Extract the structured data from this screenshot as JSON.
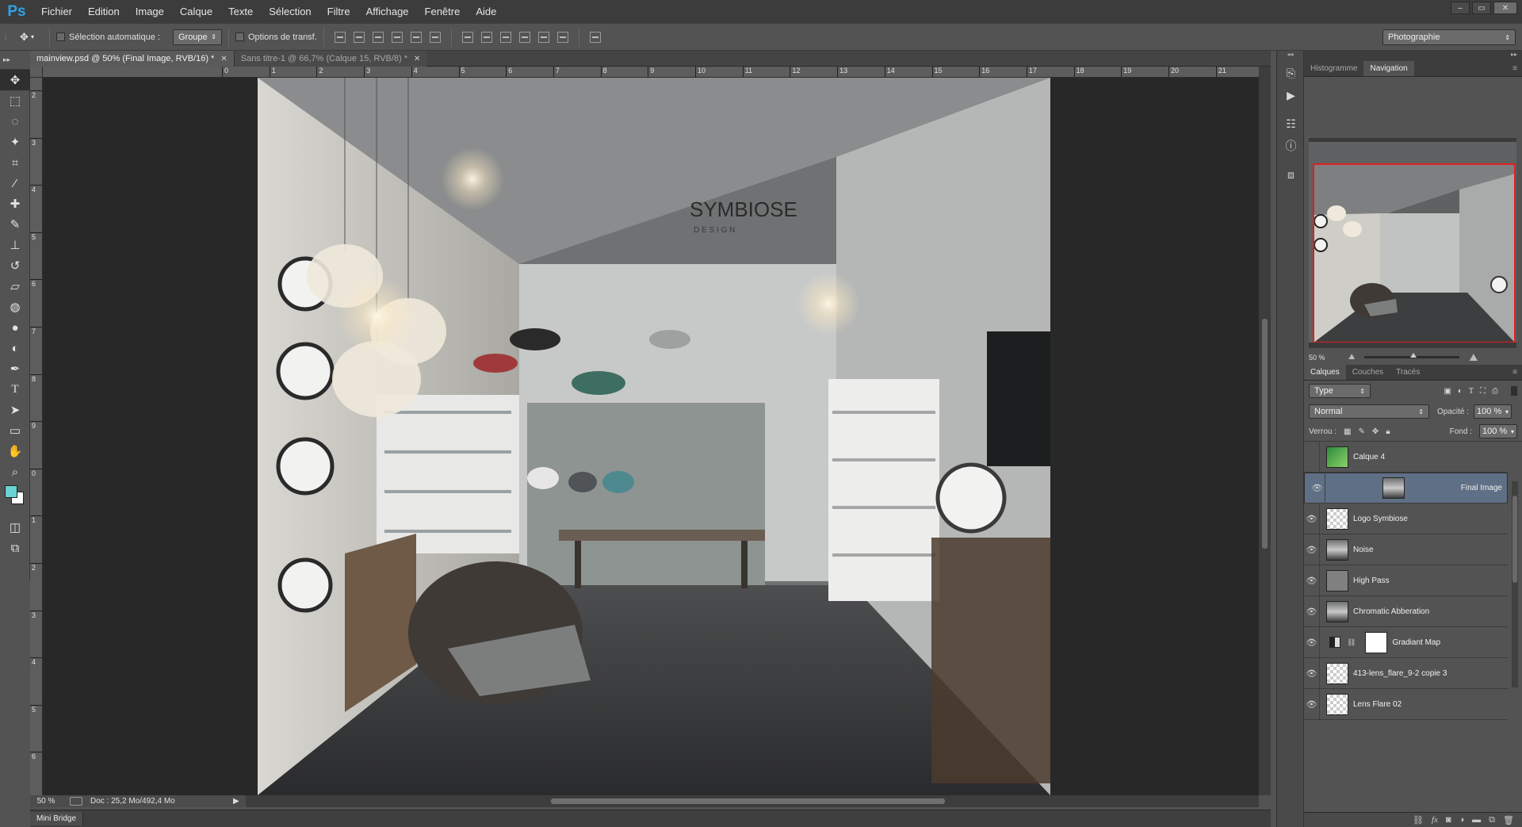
{
  "app": {
    "logo": "Ps"
  },
  "menu": [
    "Fichier",
    "Edition",
    "Image",
    "Calque",
    "Texte",
    "Sélection",
    "Filtre",
    "Affichage",
    "Fenêtre",
    "Aide"
  ],
  "window_controls": [
    "–",
    "▭",
    "✕"
  ],
  "options": {
    "auto_select_label": "Sélection automatique :",
    "auto_select_value": "Groupe",
    "transform_label": "Options de transf.",
    "workspace": "Photographie"
  },
  "tabs": [
    {
      "label": "mainview.psd @ 50% (Final Image, RVB/16) *",
      "close": "✕"
    },
    {
      "label": "Sans titre-1 @ 66,7% (Calque 15, RVB/8) *",
      "close": "✕"
    }
  ],
  "ruler": {
    "h": [
      "0",
      "1",
      "2",
      "3",
      "4",
      "5",
      "6",
      "7",
      "8",
      "9",
      "10",
      "11",
      "12",
      "13",
      "14",
      "15",
      "16",
      "17",
      "18",
      "19",
      "20",
      "21"
    ],
    "v": [
      "2",
      "3",
      "4",
      "5",
      "6",
      "7",
      "8",
      "9",
      "0",
      "1",
      "2",
      "3",
      "4",
      "5",
      "6"
    ]
  },
  "canvas": {
    "logo_title": "SYMBIOSE",
    "logo_sub": "D E S I G N"
  },
  "status": {
    "zoom": "50 %",
    "doc": "Doc : 25,2 Mo/492,4 Mo"
  },
  "mini_bridge": "Mini Bridge",
  "nav_panel": {
    "tabs": [
      "Histogramme",
      "Navigation"
    ],
    "active": "Navigation",
    "zoom": "50 %"
  },
  "layers_panel": {
    "tabs": [
      "Calques",
      "Couches",
      "Tracés"
    ],
    "filter": "Type",
    "blend_mode": "Normal",
    "opacity_label": "Opacité :",
    "opacity": "100 %",
    "lock_label": "Verrou :",
    "fill_label": "Fond :",
    "fill": "100 %",
    "layers": [
      {
        "name": "Calque 4",
        "visible": false,
        "thumb": "green"
      },
      {
        "name": "Final Image",
        "visible": true,
        "thumb": "photo",
        "selected": true
      },
      {
        "name": "Logo Symbiose",
        "visible": true,
        "thumb": "checker"
      },
      {
        "name": "Noise",
        "visible": true,
        "thumb": "photo"
      },
      {
        "name": "High Pass",
        "visible": true,
        "thumb": "gray"
      },
      {
        "name": "Chromatic Abberation",
        "visible": true,
        "thumb": "photo"
      },
      {
        "name": "Gradiant Map",
        "visible": true,
        "thumb": "adjust"
      },
      {
        "name": "413-lens_flare_9-2 copie 3",
        "visible": true,
        "thumb": "checker"
      },
      {
        "name": "Lens Flare 02",
        "visible": true,
        "thumb": "checker"
      }
    ]
  },
  "colors": {
    "accent": "#2fa3e8",
    "foreground_swatch": "#6ad2d2",
    "background_swatch": "#ffffff",
    "selection": "#5f6f86",
    "nav_frame": "#e01f1f"
  }
}
